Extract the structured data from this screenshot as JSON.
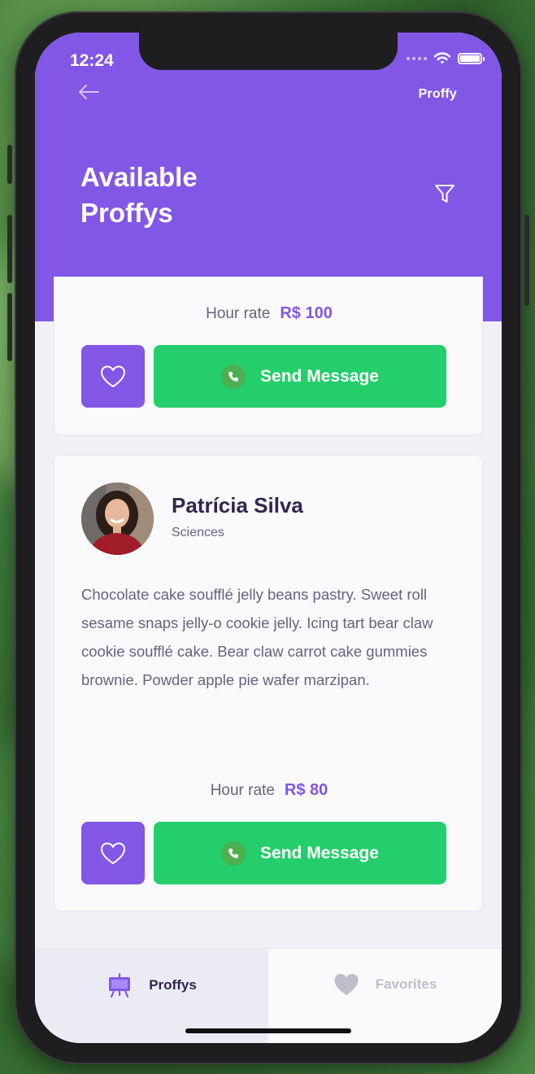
{
  "status_bar": {
    "time": "12:24"
  },
  "header": {
    "logo": "Proffy",
    "title_line1": "Available",
    "title_line2": "Proffys"
  },
  "icons": {
    "back": "arrow-left-icon",
    "filter": "filter-icon",
    "favorite": "heart-icon",
    "whatsapp": "whatsapp-icon",
    "tab_proffys": "easel-icon",
    "tab_favorites": "heart-icon"
  },
  "cards": [
    {
      "rate_label": "Hour rate",
      "rate_value": "R$ 100",
      "send_label": "Send Message"
    },
    {
      "name": "Patrícia Silva",
      "subject": "Sciences",
      "bio": "Chocolate cake soufflé jelly beans pastry. Sweet roll sesame snaps jelly-o cookie jelly. Icing tart bear claw cookie soufflé cake. Bear claw carrot cake gummies brownie. Powder apple pie wafer marzipan.",
      "rate_label": "Hour rate",
      "rate_value": "R$ 80",
      "send_label": "Send Message"
    }
  ],
  "tabs": [
    {
      "label": "Proffys",
      "active": true
    },
    {
      "label": "Favorites",
      "active": false
    }
  ],
  "colors": {
    "primary": "#8257e5",
    "secondary": "#23ce6b",
    "text_title": "#32264d",
    "text_base": "#6a6180"
  }
}
